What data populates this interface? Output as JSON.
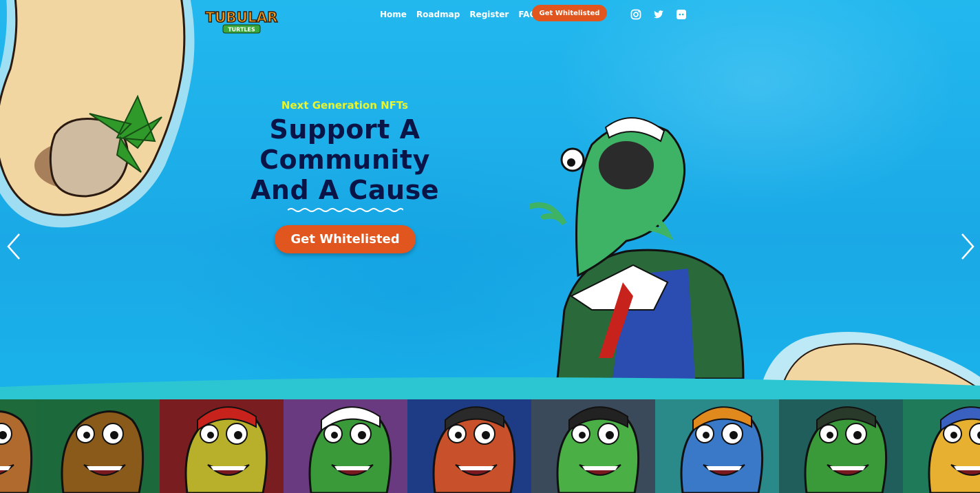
{
  "brand": {
    "logo_line1": "TUBULAR",
    "logo_line2": "TURTLES"
  },
  "nav": {
    "items": [
      "Home",
      "Roadmap",
      "Register",
      "FAQ"
    ],
    "cta_label": "Get Whitelisted"
  },
  "social": [
    "instagram-icon",
    "twitter-icon",
    "discord-icon"
  ],
  "hero": {
    "eyebrow": "Next Generation NFTs",
    "headline_lines": [
      "Support A",
      "Community",
      "And A Cause"
    ],
    "cta_label": "Get Whitelisted"
  },
  "carousel": {
    "prev_icon": "chevron-left-icon",
    "next_icon": "chevron-right-icon"
  },
  "colors": {
    "ocean": "#1fb6ea",
    "accent_orange": "#e0561e",
    "eyebrow_yellow": "#e9f52a",
    "headline_navy": "#0a1447",
    "wave_teal": "#2cc6d2"
  },
  "gallery": {
    "tiles": [
      {
        "bg": "#1f6a3a",
        "skin": "#b06a2e",
        "hat": ""
      },
      {
        "bg": "#1c6a3c",
        "skin": "#8a5a1a",
        "hat": ""
      },
      {
        "bg": "#7a1d20",
        "skin": "#b8b02a",
        "hat": "#c8221c"
      },
      {
        "bg": "#6a3a80",
        "skin": "#3a9a3a",
        "hat": "#ffffff"
      },
      {
        "bg": "#1e3c86",
        "skin": "#c8502a",
        "hat": "#2a2a2a"
      },
      {
        "bg": "#3b4a5a",
        "skin": "#4ab046",
        "hat": "#222222"
      },
      {
        "bg": "#2a8a8a",
        "skin": "#3a78c8",
        "hat": "#e08a1e"
      },
      {
        "bg": "#1f5e5a",
        "skin": "#3a9a3a",
        "hat": "#2a3a2a"
      },
      {
        "bg": "#1f7a5a",
        "skin": "#e8b030",
        "hat": "#3a60c0"
      }
    ]
  }
}
